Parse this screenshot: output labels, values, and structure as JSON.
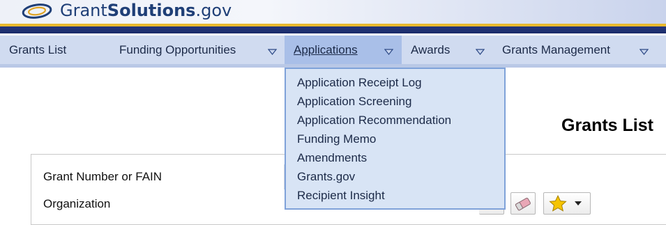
{
  "header": {
    "logo_text_regular": "Grant",
    "logo_text_bold": "Solutions",
    "logo_text_suffix": ".gov"
  },
  "nav": {
    "items": [
      {
        "label": "Grants List",
        "has_dropdown": false
      },
      {
        "label": "Funding Opportunities",
        "has_dropdown": true
      },
      {
        "label": "Applications",
        "has_dropdown": true,
        "active": true
      },
      {
        "label": "Awards",
        "has_dropdown": true
      },
      {
        "label": "Grants Management",
        "has_dropdown": true
      }
    ]
  },
  "applications_menu": {
    "items": [
      "Application Receipt Log",
      "Application Screening",
      "Application Recommendation",
      "Funding Memo",
      "Amendments",
      "Grants.gov",
      "Recipient Insight"
    ]
  },
  "main": {
    "title": "Grants List",
    "fields": {
      "grant_number_label": "Grant Number or FAIN",
      "organization_label": "Organization"
    }
  },
  "icons": {
    "clear": "eraser-icon",
    "favorites": "star-icon"
  },
  "colors": {
    "brand_navy": "#1f3f77",
    "gold_stripe": "#e8b92e",
    "nav_bg": "#d0dbf0",
    "nav_active": "#a9bfe8",
    "dropdown_bg": "#d8e4f5",
    "dropdown_border": "#7fa2d9",
    "star": "#f5c400"
  }
}
